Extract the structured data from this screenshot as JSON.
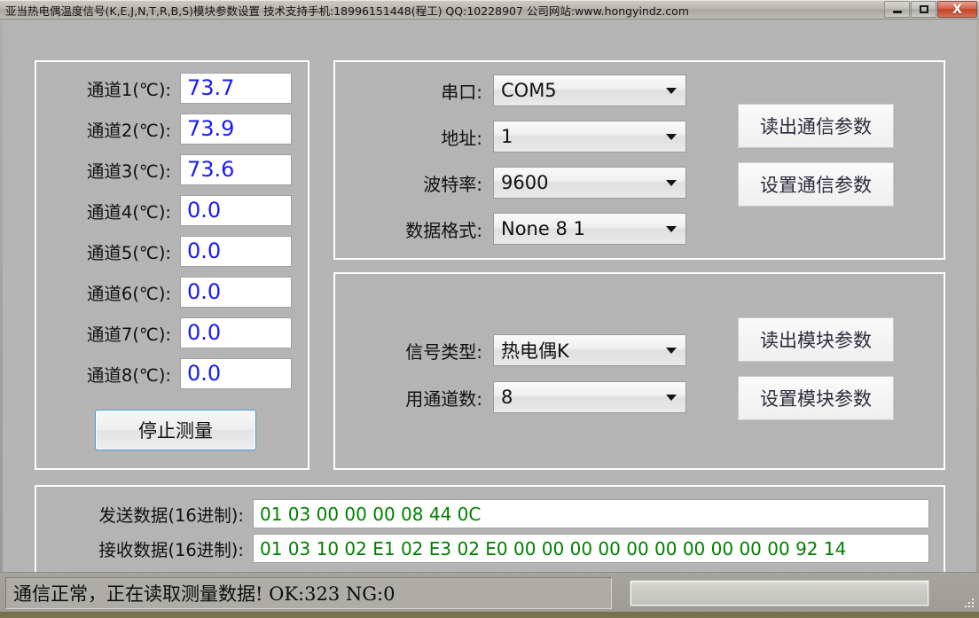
{
  "window": {
    "title": "亚当热电偶温度信号(K,E,J,N,T,R,B,S)模块参数设置    技术支持手机:18996151448(程工)  QQ:10228907   公司网站:www.hongyindz.com",
    "caption_buttons": {
      "minimize": "minimize-icon",
      "maximize": "maximize-icon",
      "close": "X"
    }
  },
  "channels": {
    "rows": [
      {
        "label": "通道1(℃):",
        "value": "73.7"
      },
      {
        "label": "通道2(℃):",
        "value": "73.9"
      },
      {
        "label": "通道3(℃):",
        "value": "73.6"
      },
      {
        "label": "通道4(℃):",
        "value": "0.0"
      },
      {
        "label": "通道5(℃):",
        "value": "0.0"
      },
      {
        "label": "通道6(℃):",
        "value": "0.0"
      },
      {
        "label": "通道7(℃):",
        "value": "0.0"
      },
      {
        "label": "通道8(℃):",
        "value": "0.0"
      }
    ],
    "stop_button": "停止测量",
    "value_color": "#1a1aff"
  },
  "comm": {
    "rows": [
      {
        "label": "串口:",
        "value": "COM5"
      },
      {
        "label": "地址:",
        "value": "1"
      },
      {
        "label": "波特率:",
        "value": "9600"
      },
      {
        "label": "数据格式:",
        "value": "None 8 1"
      }
    ],
    "read_button": "读出通信参数",
    "set_button": "设置通信参数"
  },
  "module": {
    "rows": [
      {
        "label": "信号类型:",
        "value": "热电偶K"
      },
      {
        "label": "用通道数:",
        "value": "8"
      }
    ],
    "read_button": "读出模块参数",
    "set_button": "设置模块参数"
  },
  "data_io": {
    "send_label": "发送数据(16进制):",
    "send_value": "01 03 00 00 00 08 44 0C",
    "recv_label": "接收数据(16进制):",
    "recv_value": "01 03 10 02 E1 02 E3 02 E0 00 00 00 00 00 00 00 00 00 00 92 14",
    "text_color": "#008000"
  },
  "status": {
    "message": "通信正常，正在读取测量数据! OK:323  NG:0",
    "progress_percent": 0
  }
}
